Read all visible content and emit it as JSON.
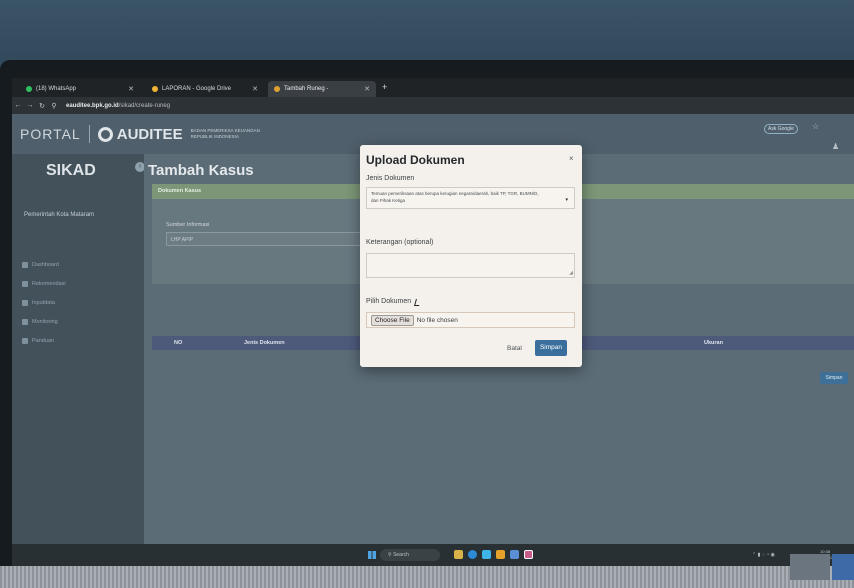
{
  "browser": {
    "tabs": [
      {
        "label": "(18) WhatsApp",
        "color": "#2fbf5f"
      },
      {
        "label": "LAPORAN - Google Drive",
        "color": "#f2b233"
      },
      {
        "label": "Tambah Runeg -",
        "color": "#e0a030"
      }
    ],
    "url_host": "eauditee.bpk.go.id",
    "url_path": "/sikad/create-runeg",
    "ask_google": "Ask Google"
  },
  "header": {
    "portal": "PORTAL",
    "brand": "AUDITEE",
    "org_line1": "BADAN PEMERIKSA KEUANGAN",
    "org_line2": "REPUBLIK INDONESIA"
  },
  "sidebar": {
    "app_name": "SIKAD",
    "org": "Pemerintah Kota Mataram",
    "items": [
      "Dashboard",
      "Rekomendasi",
      "Inputdata",
      "Monitoring",
      "Panduan"
    ]
  },
  "main": {
    "title": "Tambah Kasus",
    "card_header": "Dokumen Kasus",
    "source_label": "Sumber Informasi",
    "source_value": "LHP APIP",
    "col_no": "NO",
    "col_jenis": "Jenis Dokumen",
    "col_ukuran": "Ukuran",
    "save_label": "Simpan"
  },
  "modal": {
    "title": "Upload Dokumen",
    "close": "×",
    "jenis_label": "Jenis Dokumen",
    "jenis_value_line1": "Temuan pemeriksaan atas berupa kerugian negara/daerah, baik TP, TGR, BUMN/D,",
    "jenis_value_line2": "dan Pihak Ketiga",
    "keterangan_label": "Keterangan (optional)",
    "file_label": "Pilih Dokumen",
    "choose_file": "Choose File",
    "no_file": "No file chosen",
    "cancel": "Batal",
    "submit": "Simpan"
  },
  "taskbar": {
    "search": "Search",
    "clock_time": "10:38",
    "clock_date": "06/12/2024"
  }
}
